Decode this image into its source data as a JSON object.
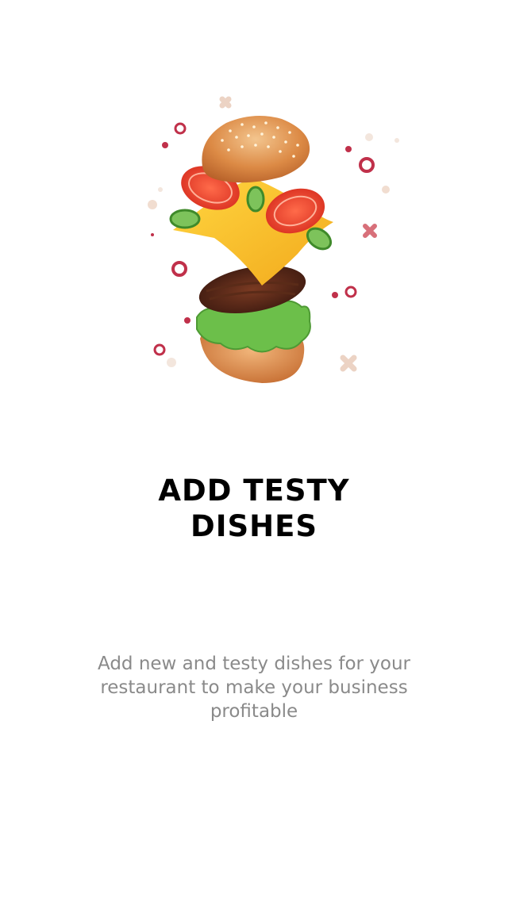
{
  "onboarding": {
    "illustration": "burger-ingredients-illustration",
    "title_line1": "ADD TESTY",
    "title_line2": "DISHES",
    "description": "Add new and testy dishes for your restaurant to make your business profitable"
  },
  "colors": {
    "title": "#000000",
    "description": "#8a8a8a",
    "background": "#ffffff",
    "accent": "#c0304a"
  }
}
